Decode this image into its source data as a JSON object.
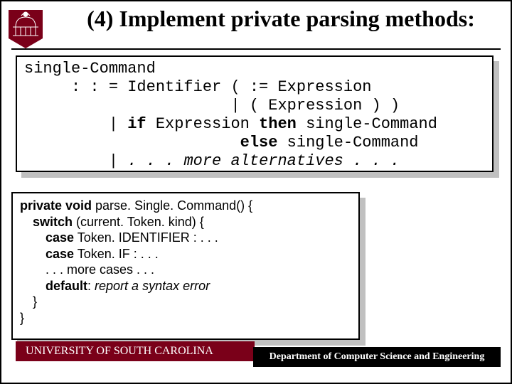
{
  "title": "(4) Implement private parsing methods:",
  "grammar": {
    "l1": "single-Command",
    "l2_a": "     : : = Identifier ( := Expression",
    "l3": "                      | ( Expression ) )",
    "l4_a": "         | ",
    "l4_if": "if",
    "l4_b": " Expression ",
    "l4_then": "then",
    "l4_c": " single-Command",
    "l5_a": "                       ",
    "l5_else": "else",
    "l5_b": " single-Command",
    "l6_a": "         | ",
    "l6_more": ". . . more alternatives . . ."
  },
  "code": {
    "l1_a": "private void",
    "l1_b": " parse. Single. Command() {",
    "l2_a": "switch",
    "l2_b": " (current. Token. kind) {",
    "l3_a": "case",
    "l3_b": " Token. IDENTIFIER : . . .",
    "l4_a": "case",
    "l4_b": " Token. IF : . . .",
    "l5": ". . . more cases . . .",
    "l6_a": "default",
    "l6_b": ": ",
    "l6_c": "report a syntax error",
    "l7": "}",
    "l8": "}"
  },
  "footer": {
    "left": "UNIVERSITY OF SOUTH CAROLINA",
    "right": "Department of Computer Science and Engineering"
  }
}
